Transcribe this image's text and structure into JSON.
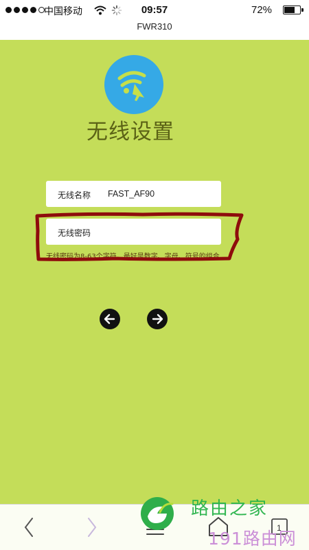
{
  "status_bar": {
    "carrier": "中国移动",
    "time": "09:57",
    "battery_percent": "72%",
    "battery_level": 0.72,
    "signal_bars_filled": 4,
    "signal_bars_total": 5
  },
  "browser": {
    "page_title": "FWR310"
  },
  "page": {
    "heading": "无线设置",
    "wifi_name": {
      "label": "无线名称",
      "value": "FAST_AF90"
    },
    "wifi_password": {
      "label": "无线密码",
      "value": ""
    },
    "hint": "无线密码为8-63个字符，最好是数字、字母、符号的组合"
  },
  "watermark": {
    "line1": "路由之家",
    "line2": "191路由网"
  },
  "toolbar": {
    "tabs_count": "1"
  },
  "colors": {
    "background": "#c4dd59",
    "logo_blue": "#35a9e6",
    "logo_symbol": "#c6df4a",
    "highlight_red": "#8e0c0c",
    "watermark_green": "#28b34a",
    "watermark_purple": "#c98ad6"
  },
  "icons": {
    "wifi_logo": "wifi-pointer-icon",
    "prev": "arrow-left-circle-icon",
    "next": "arrow-right-circle-icon",
    "back": "chevron-left-icon",
    "forward": "chevron-right-icon",
    "menu": "hamburger-menu-icon",
    "home": "home-icon",
    "tabs": "tabs-icon"
  }
}
